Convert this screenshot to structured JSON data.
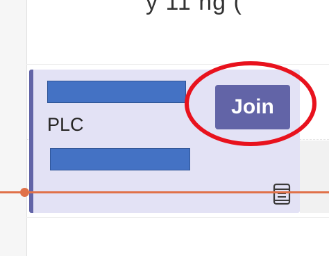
{
  "header": {
    "cut_text": "y 11 ng (",
    "note": ""
  },
  "meeting": {
    "title_redacted": "",
    "org_label": "PLC",
    "detail_redacted": "",
    "join_label": "Join",
    "chat_icon": "chat-icon"
  },
  "colors": {
    "card_bg": "#e3e2f5",
    "accent": "#6264a7",
    "redaction": "#4472c4",
    "time_line": "#e07149",
    "highlight": "#e8121d"
  }
}
